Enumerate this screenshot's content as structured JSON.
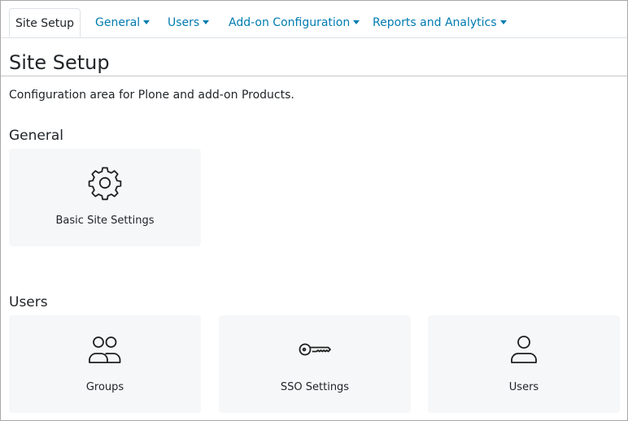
{
  "tabs": [
    {
      "label": "Site Setup",
      "active": true
    },
    {
      "label": "General",
      "dropdown": true
    },
    {
      "label": "Users",
      "dropdown": true
    },
    {
      "label": "Add-on Configuration",
      "dropdown": true
    },
    {
      "label": "Reports and Analytics",
      "dropdown": true
    }
  ],
  "page": {
    "title": "Site Setup",
    "description": "Configuration area for Plone and add-on Products."
  },
  "sections": {
    "general": {
      "title": "General",
      "items": [
        {
          "label": "Basic Site Settings",
          "icon": "gear-icon"
        }
      ]
    },
    "users": {
      "title": "Users",
      "items": [
        {
          "label": "Groups",
          "icon": "people-icon"
        },
        {
          "label": "SSO Settings",
          "icon": "key-icon"
        },
        {
          "label": "Users",
          "icon": "person-icon"
        }
      ]
    }
  },
  "colors": {
    "link": "#007bb1",
    "card_background": "#f6f7f8",
    "text": "#212529"
  }
}
